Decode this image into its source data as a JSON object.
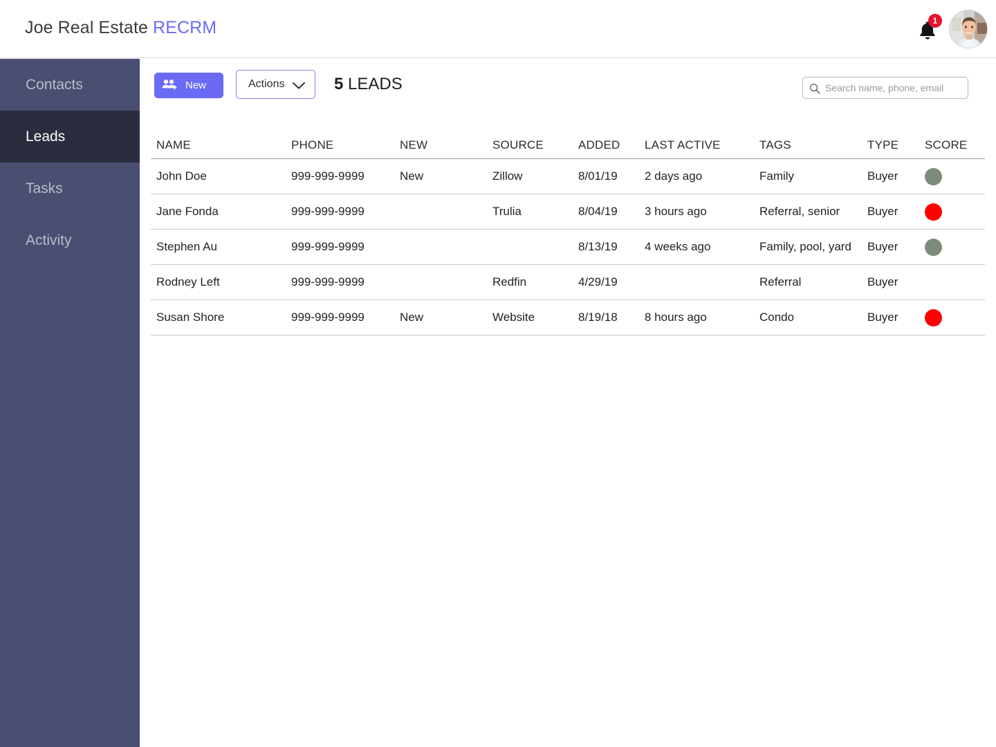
{
  "header": {
    "brand_main": "Joe Real Estate",
    "brand_accent": "RECRM",
    "accent_color": "#6a6af5",
    "notification_count": "1",
    "notification_badge_color": "#e8112d"
  },
  "sidebar": {
    "items": [
      {
        "label": "Contacts",
        "active": false
      },
      {
        "label": "Leads",
        "active": true
      },
      {
        "label": "Tasks",
        "active": false
      },
      {
        "label": "Activity",
        "active": false
      }
    ]
  },
  "toolbar": {
    "new_label": "New",
    "actions_label": "Actions",
    "count_number": "5",
    "count_label": " LEADS",
    "search_placeholder": "Search name, phone, email",
    "search_value": ""
  },
  "table": {
    "columns": [
      "NAME",
      "PHONE",
      "NEW",
      "SOURCE",
      "ADDED",
      "LAST ACTIVE",
      "TAGS",
      "TYPE",
      "SCORE"
    ],
    "score_colors": {
      "green": "#7c8a7c",
      "red": "#fe0000"
    },
    "rows": [
      {
        "name": "John Doe",
        "phone": "999-999-9999",
        "new": "New",
        "source": "Zillow",
        "added": "8/01/19",
        "last_active": "2 days ago",
        "tags": "Family",
        "type": "Buyer",
        "score": "green"
      },
      {
        "name": "Jane Fonda",
        "phone": "999-999-9999",
        "new": "",
        "source": "Trulia",
        "added": "8/04/19",
        "last_active": "3 hours ago",
        "tags": "Referral, senior",
        "type": "Buyer",
        "score": "red"
      },
      {
        "name": "Stephen Au",
        "phone": "999-999-9999",
        "new": "",
        "source": "",
        "added": "8/13/19",
        "last_active": "4 weeks ago",
        "tags": "Family, pool, yard",
        "type": "Buyer",
        "score": "green"
      },
      {
        "name": "Rodney Left",
        "phone": "999-999-9999",
        "new": "",
        "source": "Redfin",
        "added": "4/29/19",
        "last_active": "",
        "tags": "Referral",
        "type": "Buyer",
        "score": ""
      },
      {
        "name": "Susan Shore",
        "phone": "999-999-9999",
        "new": "New",
        "source": "Website",
        "added": "8/19/18",
        "last_active": "8 hours ago",
        "tags": "Condo",
        "type": "Buyer",
        "score": "red"
      }
    ]
  }
}
